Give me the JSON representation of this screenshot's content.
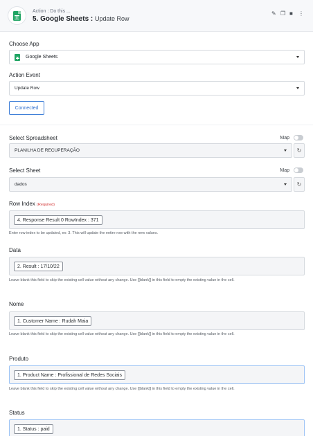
{
  "header": {
    "subtitle": "Action : Do this ...",
    "title_bold": "5. Google Sheets :",
    "title_light": "Update Row"
  },
  "choose_app": {
    "label": "Choose App",
    "value": "Google Sheets"
  },
  "action_event": {
    "label": "Action Event",
    "value": "Update Row"
  },
  "connection": {
    "label": "Connected"
  },
  "spreadsheet": {
    "label": "Select Spreadsheet",
    "map_label": "Map",
    "value": "PLANILHA DE RECUPERAÇÃO"
  },
  "sheet": {
    "label": "Select Sheet",
    "map_label": "Map",
    "value": "dados"
  },
  "row_index": {
    "label": "Row Index",
    "required": "(Required)",
    "chip": "4. Response Result 0 RowIndex : 371",
    "hint": "Enter row index to be updated, ex: 3. This will update the entire row with the new values."
  },
  "data_field": {
    "label": "Data",
    "chip": "2. Result : 17/10/22",
    "hint": "Leave blank this field to skip the existing cell value without any change. Use [[blank]] in this field to empty the existing value in the cell."
  },
  "nome_field": {
    "label": "Nome",
    "chip": "1. Customer Name : Rudah Maia",
    "hint": "Leave blank this field to skip the existing cell value without any change. Use [[blank]] in this field to empty the existing value in the cell."
  },
  "produto_field": {
    "label": "Produto",
    "chip": "1. Product Name : Profissional de Redes Sociais",
    "hint": "Leave blank this field to skip the existing cell value without any change. Use [[blank]] in this field to empty the existing value in the cell."
  },
  "status_field": {
    "label": "Status",
    "chip": "1. Status : paid"
  },
  "colors": {
    "accent": "#3f7fd8",
    "sheets_green": "#1fa463",
    "required": "#d43b3b"
  }
}
